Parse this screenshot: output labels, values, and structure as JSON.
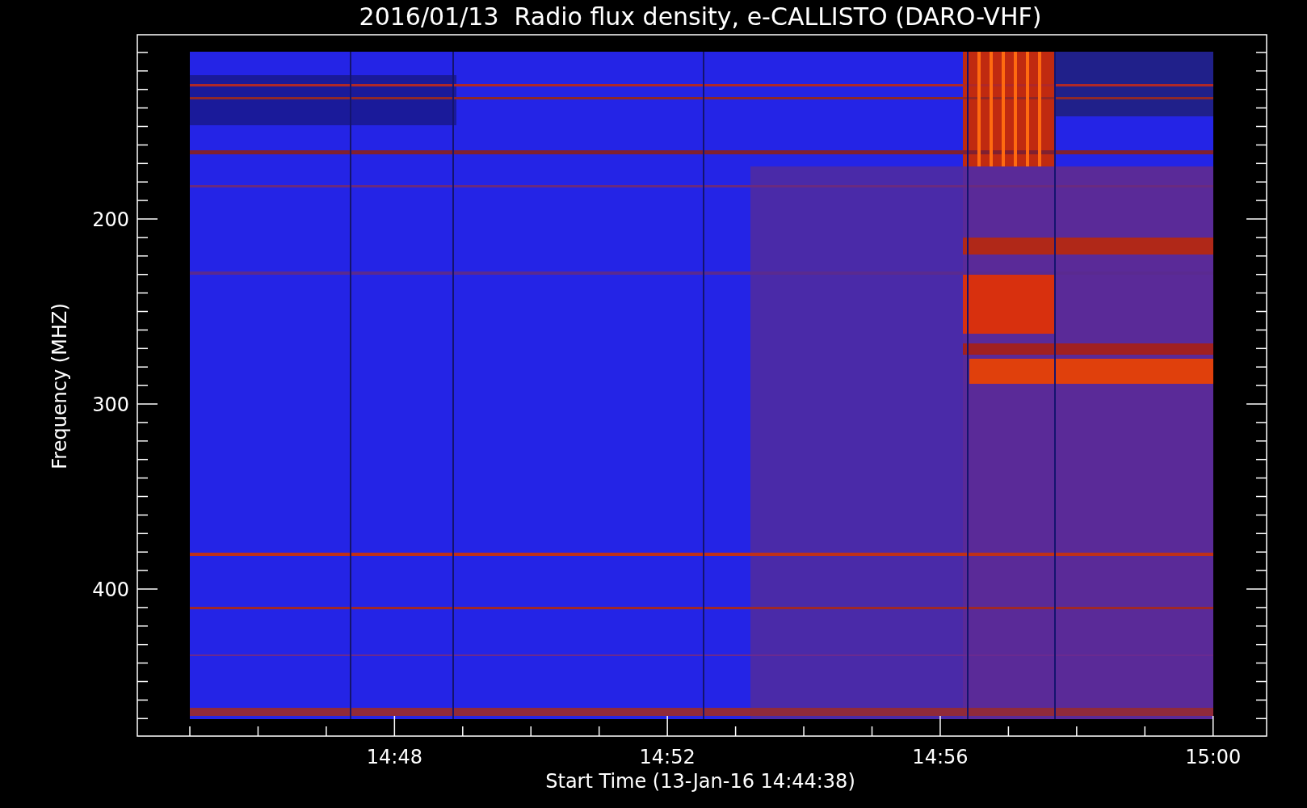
{
  "title": "2016/01/13  Radio flux density, e-CALLISTO (DARO-VHF)",
  "y_axis": {
    "label": "Frequency (MHZ)",
    "tick_labels": [
      "200",
      "300",
      "400"
    ]
  },
  "x_axis": {
    "label": "Start Time (13-Jan-16 14:44:38)",
    "tick_labels": [
      "14:48",
      "14:52",
      "14:56",
      "15:00"
    ]
  }
}
